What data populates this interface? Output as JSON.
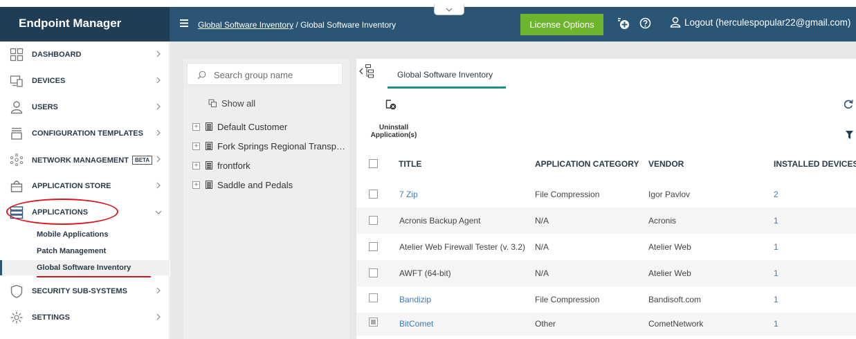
{
  "app": {
    "brand": "Endpoint Manager"
  },
  "header": {
    "breadcrumb_link": "Global Software Inventory",
    "breadcrumb_sep": " / ",
    "breadcrumb_current": "Global Software Inventory",
    "license_button": "License Options",
    "logout_label": "Logout (herculespopular22@gmail.com)"
  },
  "sidebar": {
    "items": [
      {
        "label": "DASHBOARD",
        "icon": "dashboard-icon"
      },
      {
        "label": "DEVICES",
        "icon": "devices-icon"
      },
      {
        "label": "USERS",
        "icon": "user-icon"
      },
      {
        "label": "CONFIGURATION TEMPLATES",
        "icon": "templates-icon"
      },
      {
        "label": "NETWORK MANAGEMENT",
        "icon": "network-icon",
        "badge": "BETA"
      },
      {
        "label": "APPLICATION STORE",
        "icon": "store-icon"
      },
      {
        "label": "APPLICATIONS",
        "icon": "applications-icon"
      },
      {
        "label": "SECURITY SUB-SYSTEMS",
        "icon": "shield-icon"
      },
      {
        "label": "SETTINGS",
        "icon": "gear-icon"
      }
    ],
    "sub_items": [
      {
        "label": "Mobile Applications"
      },
      {
        "label": "Patch Management"
      },
      {
        "label": "Global Software Inventory"
      }
    ]
  },
  "groups": {
    "search_placeholder": "Search group name",
    "show_all": "Show all",
    "tree": [
      {
        "label": "Default Customer"
      },
      {
        "label": "Fork Springs Regional Transp…"
      },
      {
        "label": "frontfork"
      },
      {
        "label": "Saddle and Pedals"
      }
    ]
  },
  "main": {
    "tab_label": "Global Software Inventory",
    "uninstall_label": "Uninstall Application(s)",
    "columns": [
      "TITLE",
      "APPLICATION CATEGORY",
      "VENDOR",
      "INSTALLED DEVICES"
    ],
    "rows": [
      {
        "title": "7 Zip",
        "category": "File Compression",
        "vendor": "Igor Pavlov",
        "devices": "2",
        "title_link": true
      },
      {
        "title": "Acronis Backup Agent",
        "category": "N/A",
        "vendor": "Acronis",
        "devices": "1",
        "title_link": false
      },
      {
        "title": "Atelier Web Firewall Tester (v. 3.2)",
        "category": "N/A",
        "vendor": "Atelier Web",
        "devices": "1",
        "title_link": false
      },
      {
        "title": "AWFT (64-bit)",
        "category": "N/A",
        "vendor": "Atelier Web",
        "devices": "1",
        "title_link": false
      },
      {
        "title": "Bandizip",
        "category": "File Compression",
        "vendor": "Bandisoft.com",
        "devices": "1",
        "title_link": true
      },
      {
        "title": "BitComet",
        "category": "Other",
        "vendor": "CometNetwork",
        "devices": "1",
        "title_link": true
      }
    ]
  },
  "colors": {
    "brand_bg": "#1f3d55",
    "topbar_bg": "#2a5575",
    "license_green": "#6cb52d",
    "tab_accent": "#1e8f7f",
    "link_blue": "#3c7bbf",
    "annotation_red": "#d9161e"
  }
}
